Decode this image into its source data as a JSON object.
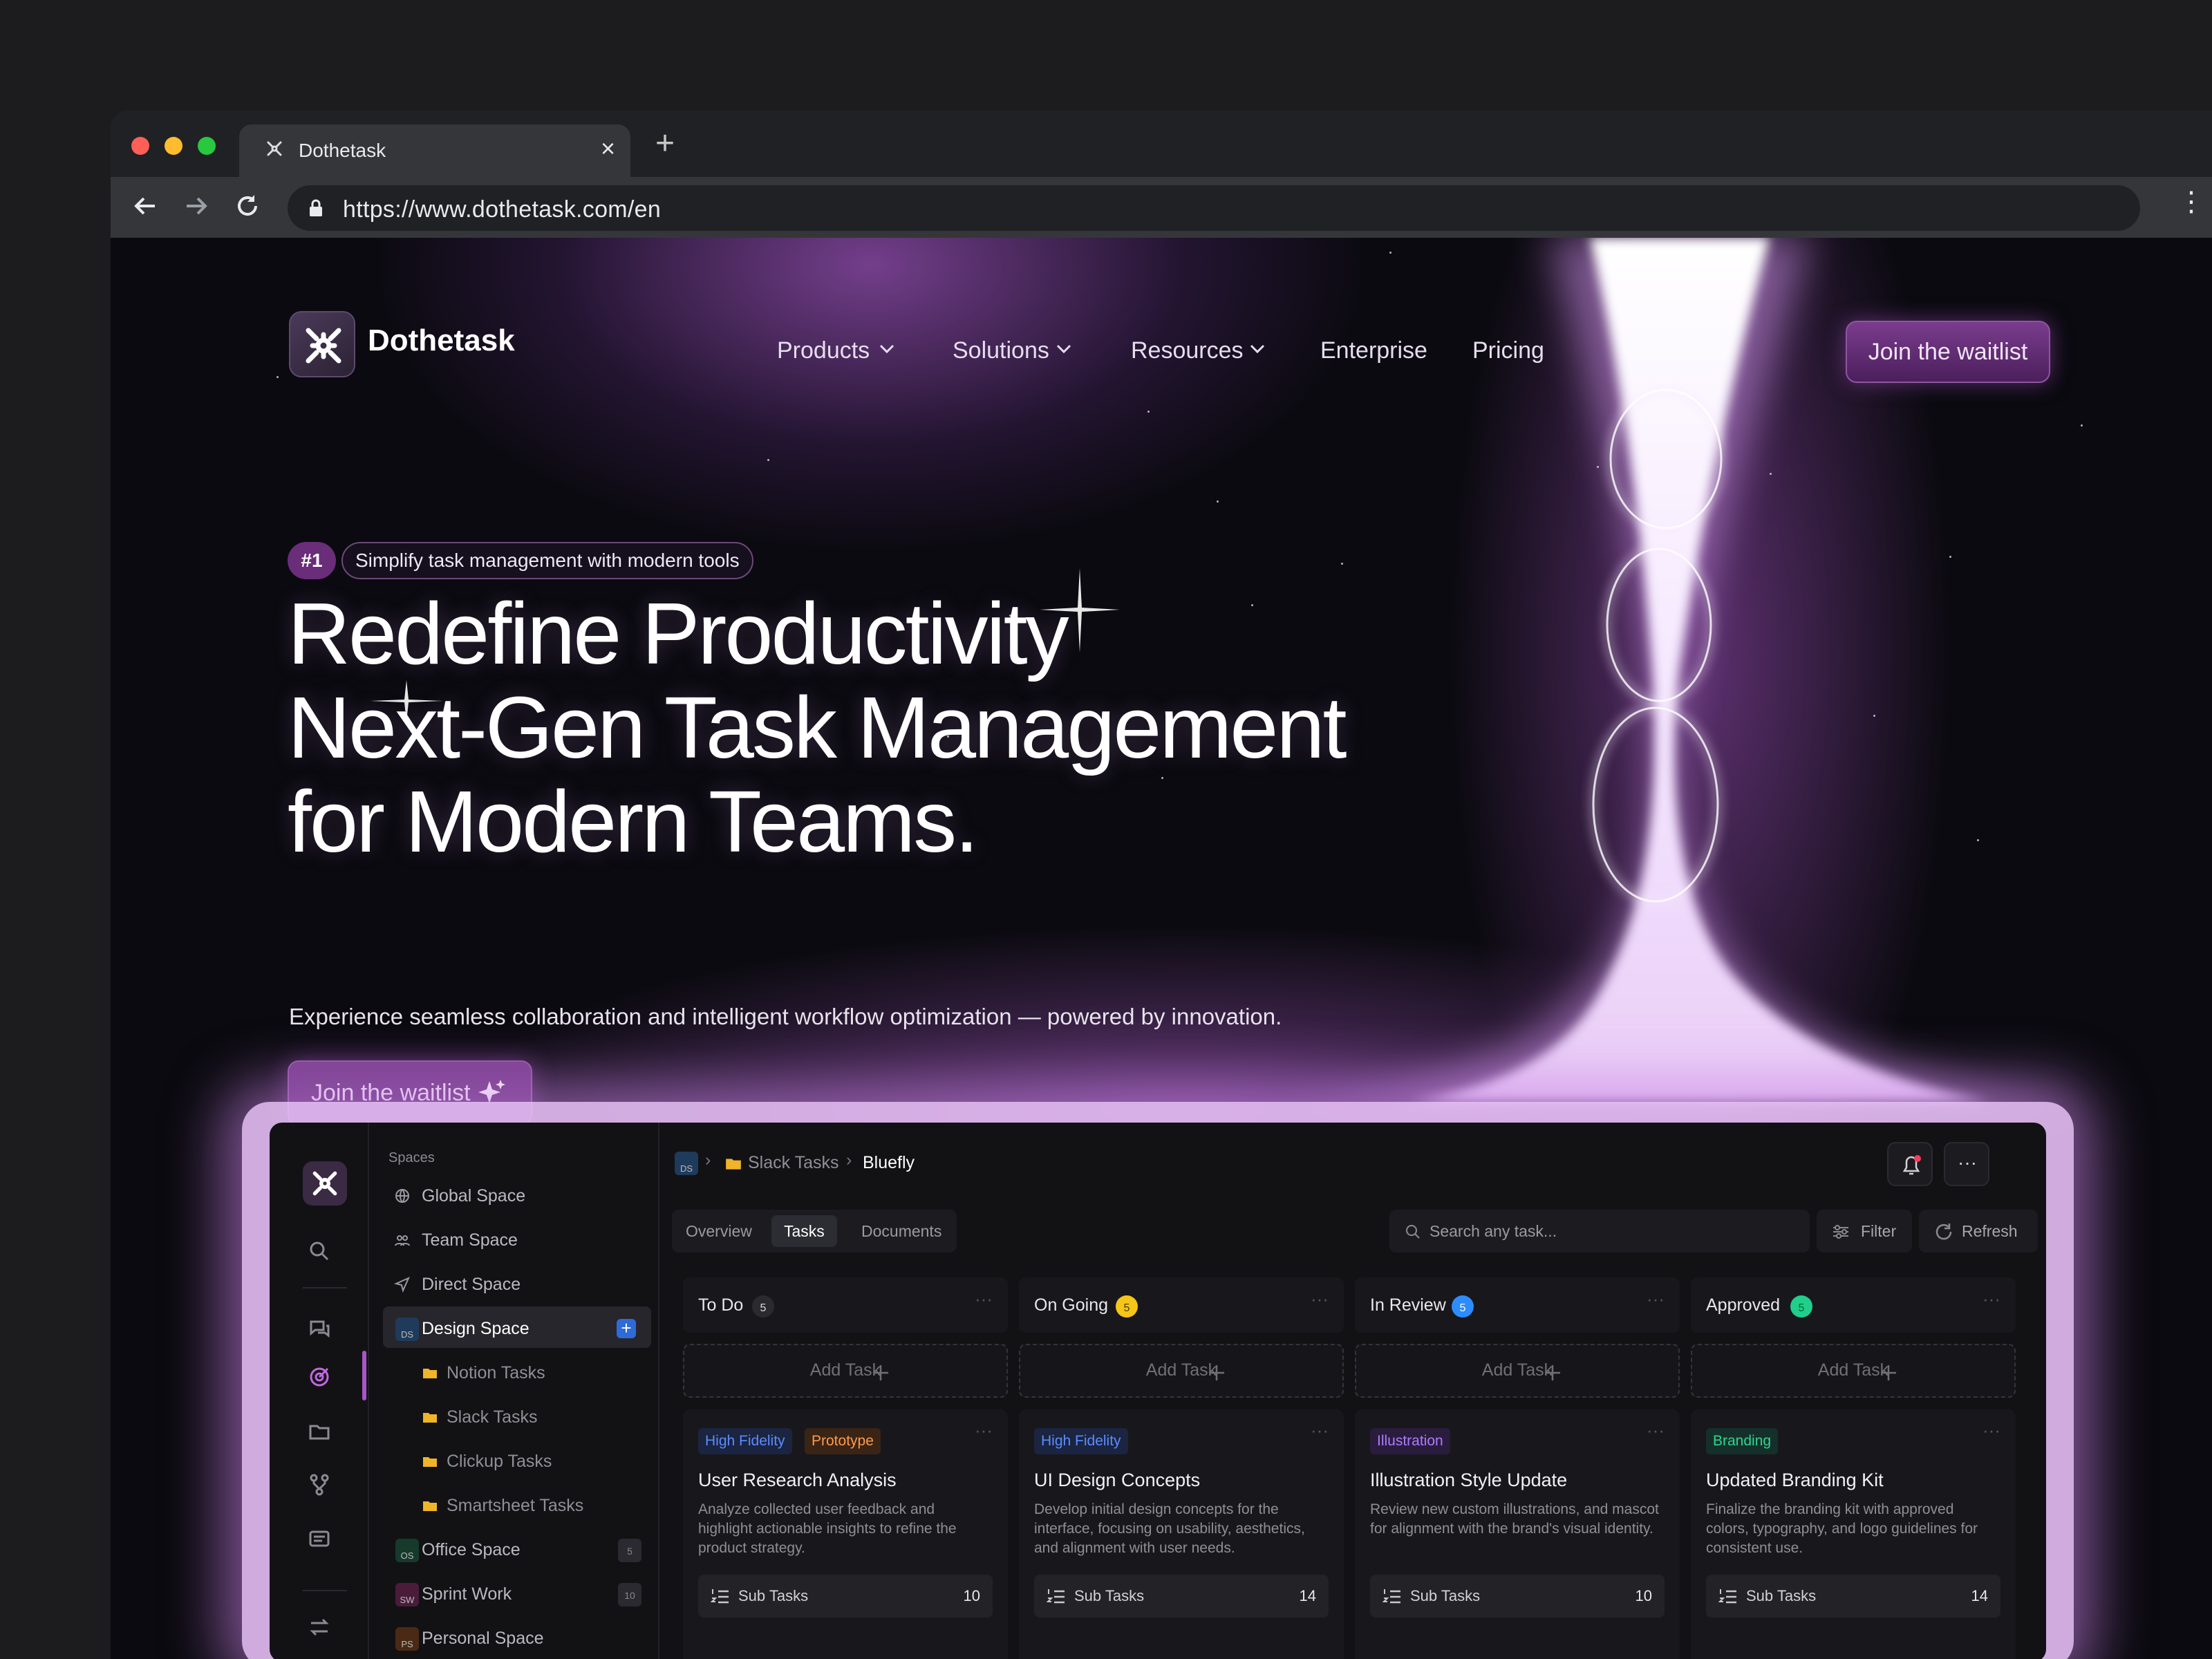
{
  "browser": {
    "tab_title": "Dothetask",
    "url": "https://www.dothetask.com/en",
    "traffic_lights": [
      "#ff5f57",
      "#febc2e",
      "#28c840"
    ]
  },
  "header": {
    "brand": "Dothetask",
    "nav": [
      {
        "label": "Products",
        "has_dropdown": true
      },
      {
        "label": "Solutions",
        "has_dropdown": true
      },
      {
        "label": "Resources",
        "has_dropdown": true
      },
      {
        "label": "Enterprise",
        "has_dropdown": false
      },
      {
        "label": "Pricing",
        "has_dropdown": false
      }
    ],
    "cta": "Join the waitlist"
  },
  "hero": {
    "badge_number": "#1",
    "badge_text": "Simplify task management with modern tools",
    "headline_1": "Redefine Productivity",
    "headline_2": "Next-Gen Task Management",
    "headline_3": "for Modern Teams.",
    "subtitle": "Experience seamless collaboration and intelligent workflow optimization — powered by innovation.",
    "cta": "Join the waitlist"
  },
  "colors": {
    "accent": "#6a2d7a",
    "cta_top": "#7a3c8d",
    "cta_bottom": "#4b1f5c",
    "background": "#0b0a10"
  },
  "app": {
    "spaces_heading": "Spaces",
    "spaces": [
      {
        "label": "Global Space",
        "icon": "globe-icon"
      },
      {
        "label": "Team Space",
        "icon": "team-icon"
      },
      {
        "label": "Direct Space",
        "icon": "send-icon"
      },
      {
        "label": "Design Space",
        "icon": "ds-avatar",
        "abbr": "DS",
        "active": true
      },
      {
        "label": "Notion Tasks",
        "icon": "folder-icon",
        "sub": true
      },
      {
        "label": "Slack Tasks",
        "icon": "folder-icon",
        "sub": true
      },
      {
        "label": "Clickup Tasks",
        "icon": "folder-icon",
        "sub": true
      },
      {
        "label": "Smartsheet Tasks",
        "icon": "folder-icon",
        "sub": true
      },
      {
        "label": "Office Space",
        "abbr": "OS",
        "count": "5"
      },
      {
        "label": "Sprint Work",
        "abbr": "SW",
        "count": "10"
      },
      {
        "label": "Personal Space",
        "abbr": "PS"
      }
    ],
    "breadcrumb": {
      "root": "DS",
      "folder": "Slack Tasks",
      "current": "Bluefly"
    },
    "tabs": [
      "Overview",
      "Tasks",
      "Documents"
    ],
    "active_tab": "Tasks",
    "search_placeholder": "Search any task...",
    "filter_label": "Filter",
    "refresh_label": "Refresh",
    "add_task_label": "Add Task",
    "subtasks_label": "Sub Tasks",
    "columns": [
      {
        "title": "To Do",
        "count": "5",
        "count_color": "#2a2a30",
        "card": {
          "tags": [
            {
              "text": "High Fidelity",
              "color": "#5b8dff",
              "bg": "#1b2440"
            },
            {
              "text": "Prototype",
              "color": "#ff9a4a",
              "bg": "#3a2416"
            }
          ],
          "title": "User Research Analysis",
          "desc": "Analyze collected user feedback and highlight actionable insights to refine the product strategy.",
          "subtasks": "10"
        }
      },
      {
        "title": "On Going",
        "count": "5",
        "count_color": "#f5c518",
        "card": {
          "tags": [
            {
              "text": "High Fidelity",
              "color": "#5b8dff",
              "bg": "#1b2440"
            }
          ],
          "title": "UI Design Concepts",
          "desc": "Develop initial design concepts for the interface, focusing on usability, aesthetics, and alignment with user needs.",
          "subtasks": "14"
        }
      },
      {
        "title": "In Review",
        "count": "5",
        "count_color": "#2d8cff",
        "card": {
          "tags": [
            {
              "text": "Illustration",
              "color": "#b07bff",
              "bg": "#2a1c3d"
            }
          ],
          "title": "Illustration Style Update",
          "desc": "Review new custom illustrations, and mascot for alignment with the brand's visual identity.",
          "subtasks": "10"
        }
      },
      {
        "title": "Approved",
        "count": "5",
        "count_color": "#1fcf8a",
        "card": {
          "tags": [
            {
              "text": "Branding",
              "color": "#2fd68f",
              "bg": "#15302a"
            }
          ],
          "title": "Updated Branding Kit",
          "desc": "Finalize the branding kit with approved colors, typography, and logo guidelines for consistent use.",
          "subtasks": "14"
        }
      }
    ]
  }
}
